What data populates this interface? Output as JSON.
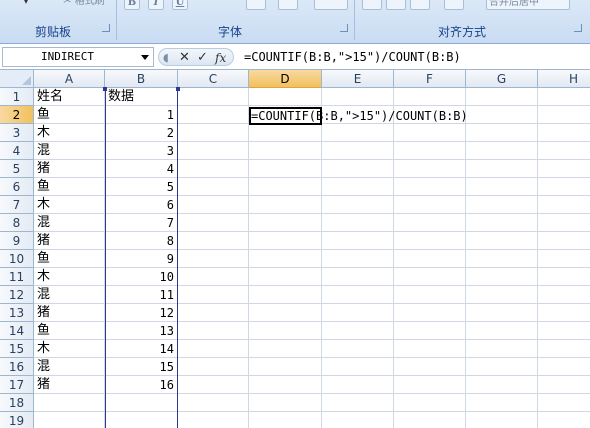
{
  "ribbon": {
    "groups": [
      {
        "label": "剪贴板"
      },
      {
        "label": "字体"
      },
      {
        "label": "对齐方式"
      }
    ],
    "font_buttons": [
      "B",
      "I",
      "U"
    ],
    "merge_button_label": "合并后居中"
  },
  "formula_bar": {
    "name_box": "INDIRECT",
    "cancel_icon": "✕",
    "enter_icon": "✓",
    "fx_label": "fx",
    "formula": "=COUNTIF(B:B,\">15\")/COUNT(B:B)"
  },
  "grid": {
    "columns": [
      "A",
      "B",
      "C",
      "D",
      "E",
      "F",
      "G",
      "H"
    ],
    "active_column": "D",
    "active_row": 2,
    "rows": [
      {
        "num": "1",
        "a": "姓名",
        "b": "数据"
      },
      {
        "num": "2",
        "a": "鱼",
        "b": "1"
      },
      {
        "num": "3",
        "a": "木",
        "b": "2"
      },
      {
        "num": "4",
        "a": "混",
        "b": "3"
      },
      {
        "num": "5",
        "a": "猪",
        "b": "4"
      },
      {
        "num": "6",
        "a": "鱼",
        "b": "5"
      },
      {
        "num": "7",
        "a": "木",
        "b": "6"
      },
      {
        "num": "8",
        "a": "混",
        "b": "7"
      },
      {
        "num": "9",
        "a": "猪",
        "b": "8"
      },
      {
        "num": "10",
        "a": "鱼",
        "b": "9"
      },
      {
        "num": "11",
        "a": "木",
        "b": "10"
      },
      {
        "num": "12",
        "a": "混",
        "b": "11"
      },
      {
        "num": "13",
        "a": "猪",
        "b": "12"
      },
      {
        "num": "14",
        "a": "鱼",
        "b": "13"
      },
      {
        "num": "15",
        "a": "木",
        "b": "14"
      },
      {
        "num": "16",
        "a": "混",
        "b": "15"
      },
      {
        "num": "17",
        "a": "猪",
        "b": "16"
      },
      {
        "num": "18",
        "a": "",
        "b": ""
      },
      {
        "num": "19",
        "a": "",
        "b": ""
      }
    ],
    "editing_cell": {
      "ref": "D2",
      "text": "=COUNTIF(B:B,\">15\")/COUNT(B:B)"
    }
  },
  "colors": {
    "ribbon_bg": "#dbe8f7",
    "active_header": "#f1c15f",
    "range_border": "#2a3b8f",
    "header_text": "#27415f"
  }
}
